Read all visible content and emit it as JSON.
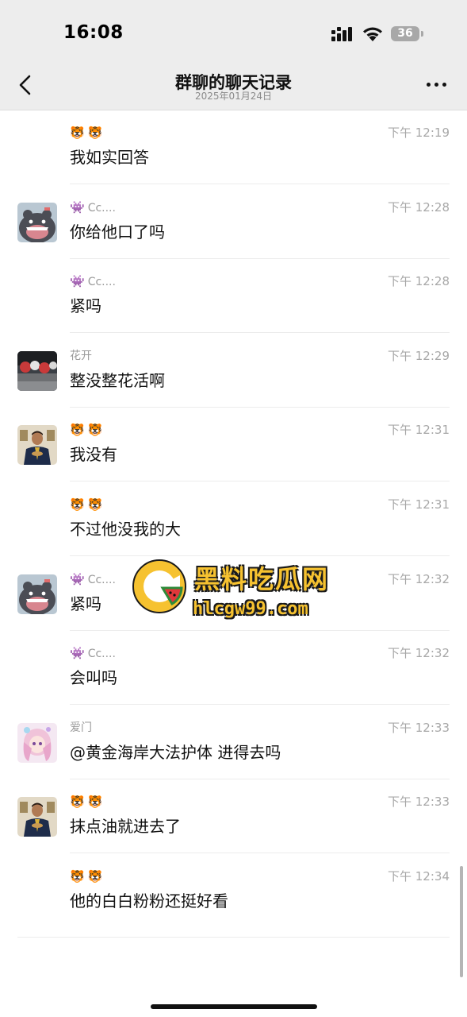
{
  "status": {
    "time": "16:08",
    "battery": "36"
  },
  "nav": {
    "title": "群聊的聊天记录",
    "date": "2025年01月24日"
  },
  "messages": [
    {
      "sender": "",
      "emoji": [
        "🐯",
        "🐯"
      ],
      "time": "下午 12:19",
      "text": "我如实回答",
      "avatar": "none"
    },
    {
      "sender": "Cc....",
      "emoji": [
        "👾"
      ],
      "time": "下午 12:28",
      "text": "你给他口了吗",
      "avatar": "cat"
    },
    {
      "sender": "Cc....",
      "emoji": [
        "👾"
      ],
      "time": "下午 12:28",
      "text": "紧吗",
      "avatar": "none"
    },
    {
      "sender": "花开",
      "emoji": [],
      "time": "下午 12:29",
      "text": "整没整花活啊",
      "avatar": "street"
    },
    {
      "sender": "",
      "emoji": [
        "🐯",
        "🐯"
      ],
      "time": "下午 12:31",
      "text": "我没有",
      "avatar": "man"
    },
    {
      "sender": "",
      "emoji": [
        "🐯",
        "🐯"
      ],
      "time": "下午 12:31",
      "text": "不过他没我的大",
      "avatar": "none"
    },
    {
      "sender": "Cc....",
      "emoji": [
        "👾"
      ],
      "time": "下午 12:32",
      "text": "紧吗",
      "avatar": "cat"
    },
    {
      "sender": "Cc....",
      "emoji": [
        "👾"
      ],
      "time": "下午 12:32",
      "text": "会叫吗",
      "avatar": "none"
    },
    {
      "sender": "爱门",
      "emoji": [],
      "time": "下午 12:33",
      "text": "@黄金海岸大法护体 进得去吗",
      "avatar": "anime"
    },
    {
      "sender": "",
      "emoji": [
        "🐯",
        "🐯"
      ],
      "time": "下午 12:33",
      "text": "抹点油就进去了",
      "avatar": "man"
    },
    {
      "sender": "",
      "emoji": [
        "🐯",
        "🐯"
      ],
      "time": "下午 12:34",
      "text": "他的白白粉粉还挺好看",
      "avatar": "none"
    }
  ],
  "watermark": {
    "title": "黑料吃瓜网",
    "url": "hlcgw99.com"
  },
  "colors": {
    "header_bg": "#ededed",
    "text": "#111111",
    "timestamp": "#a8a8a8",
    "sender": "#9a9a9a",
    "watermark": "#f6c230"
  }
}
